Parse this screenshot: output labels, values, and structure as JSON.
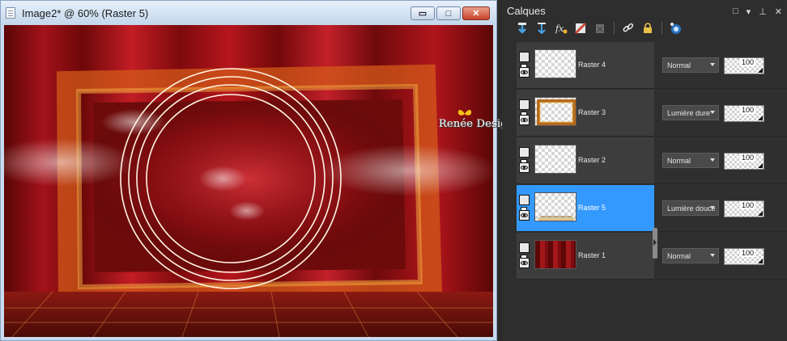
{
  "image_window": {
    "title": "Image2* @  60% (Raster 5)",
    "buttons": {
      "minimize": "▭",
      "maximize": "□",
      "close": "✕"
    },
    "icon": "document-icon"
  },
  "layers_panel": {
    "title": "Calques",
    "header_controls": [
      "□",
      "▾",
      "⊥",
      "✕"
    ],
    "toolbar_icons": [
      "new-raster-layer-icon",
      "new-vector-layer-icon",
      "new-layer-fx-icon",
      "mask-icon",
      "delete-layer-icon",
      "link-icon",
      "lock-icon",
      "palette-icon"
    ],
    "layers": [
      {
        "name": "Raster 4",
        "blend_mode": "Normal",
        "opacity": "100",
        "thumb": "transparent",
        "selected": false
      },
      {
        "name": "Raster 3",
        "blend_mode": "Lumière dure",
        "opacity": "100",
        "thumb": "frame",
        "selected": false
      },
      {
        "name": "Raster 2",
        "blend_mode": "Normal",
        "opacity": "100",
        "thumb": "transparent",
        "selected": false
      },
      {
        "name": "Raster 5",
        "blend_mode": "Lumière douce",
        "opacity": "100",
        "thumb": "floor",
        "selected": true
      },
      {
        "name": "Raster 1",
        "blend_mode": "Normal",
        "opacity": "100",
        "thumb": "red",
        "selected": false
      }
    ]
  },
  "watermark": {
    "text": "Renée Design"
  },
  "colors": {
    "selection": "#3399ff",
    "panel_bg": "#2e2e2e",
    "canvas_red": "#b3141c"
  }
}
